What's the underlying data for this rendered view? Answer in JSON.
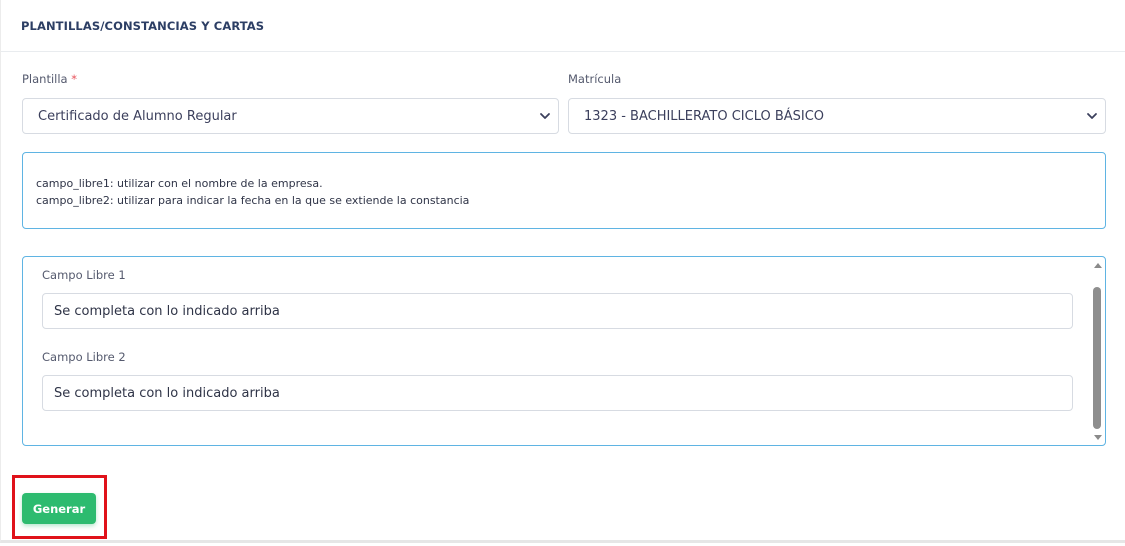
{
  "header": {
    "title": "PLANTILLAS/CONSTANCIAS Y CARTAS"
  },
  "form": {
    "plantilla": {
      "label": "Plantilla",
      "required_mark": "*",
      "value": "Certificado de Alumno Regular"
    },
    "matricula": {
      "label": "Matrícula",
      "value": "1323 - BACHILLERATO CICLO BÁSICO"
    }
  },
  "info": {
    "line1": "campo_libre1: utilizar con el nombre de la empresa.",
    "line2": "campo_libre2: utilizar para indicar la fecha en la que se extiende la constancia"
  },
  "fields": {
    "campo1": {
      "label": "Campo Libre 1",
      "value": "Se completa con lo indicado arriba"
    },
    "campo2": {
      "label": "Campo Libre 2",
      "value": "Se completa con lo indicado arriba"
    }
  },
  "actions": {
    "generate_label": "Generar"
  },
  "colors": {
    "accent_green": "#2dbb6f",
    "border_blue": "#5fb4e3",
    "highlight_red": "#e0121a",
    "required_red": "#e7515a"
  },
  "icons": {
    "select_chevron": "chevron-down-icon"
  }
}
